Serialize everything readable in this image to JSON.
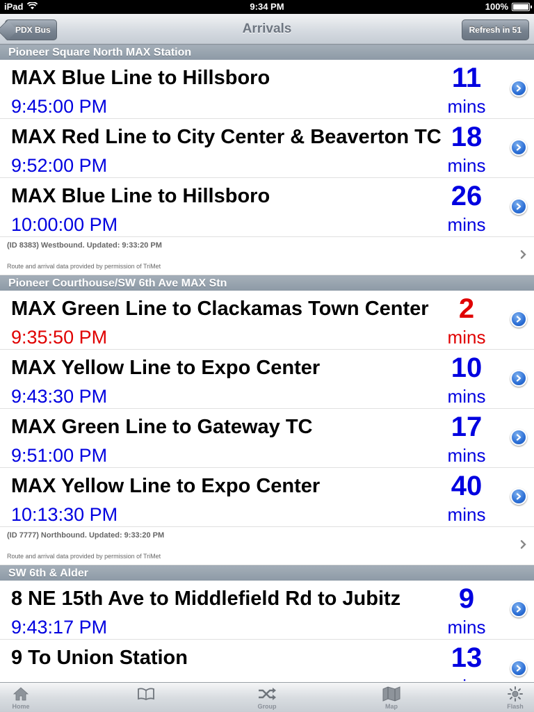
{
  "status_bar": {
    "device": "iPad",
    "time": "9:34 PM",
    "battery": "100%"
  },
  "nav": {
    "back_label": "PDX Bus",
    "title": "Arrivals",
    "refresh_label": "Refresh in 51"
  },
  "sections": [
    {
      "header": "Pioneer Square North MAX Station",
      "rows": [
        {
          "route": "MAX  Blue Line to Hillsboro",
          "time": "9:45:00 PM",
          "mins": "11",
          "mins_label": "mins",
          "late": false
        },
        {
          "route": "MAX  Red Line to City Center & Beaverton TC",
          "time": "9:52:00 PM",
          "mins": "18",
          "mins_label": "mins",
          "late": false
        },
        {
          "route": "MAX  Blue Line to Hillsboro",
          "time": "10:00:00 PM",
          "mins": "26",
          "mins_label": "mins",
          "late": false
        }
      ],
      "info": {
        "line1": "(ID 8383) Westbound. Updated: 9:33:20 PM",
        "line2": "Route and arrival data provided by permission of TriMet"
      }
    },
    {
      "header": "Pioneer Courthouse/SW 6th Ave MAX Stn",
      "rows": [
        {
          "route": "MAX  Green Line to Clackamas Town Center",
          "time": "9:35:50 PM",
          "mins": "2",
          "mins_label": "mins",
          "late": true
        },
        {
          "route": "MAX  Yellow Line to Expo Center",
          "time": "9:43:30 PM",
          "mins": "10",
          "mins_label": "mins",
          "late": false
        },
        {
          "route": "MAX  Green Line to Gateway TC",
          "time": "9:51:00 PM",
          "mins": "17",
          "mins_label": "mins",
          "late": false
        },
        {
          "route": "MAX  Yellow Line to Expo Center",
          "time": "10:13:30 PM",
          "mins": "40",
          "mins_label": "mins",
          "late": false
        }
      ],
      "info": {
        "line1": "(ID 7777) Northbound. Updated: 9:33:20 PM",
        "line2": "Route and arrival data provided by permission of TriMet"
      }
    },
    {
      "header": "SW 6th & Alder",
      "rows": [
        {
          "route": "8  NE 15th Ave to Middlefield Rd to Jubitz",
          "time": "9:43:17 PM",
          "mins": "9",
          "mins_label": "mins",
          "late": false
        },
        {
          "route": "9  To Union Station",
          "time": "",
          "mins": "13",
          "mins_label": "mins",
          "late": false
        }
      ]
    }
  ],
  "tabs": [
    {
      "label": "Home",
      "icon": "home-icon"
    },
    {
      "label": "",
      "icon": "book-icon"
    },
    {
      "label": "Group",
      "icon": "shuffle-icon"
    },
    {
      "label": "Map",
      "icon": "map-icon"
    },
    {
      "label": "Flash",
      "icon": "flash-icon"
    }
  ],
  "colors": {
    "time_blue": "#0000e0",
    "late_red": "#e00000",
    "disclosure_blue": "#2c6fd6"
  }
}
